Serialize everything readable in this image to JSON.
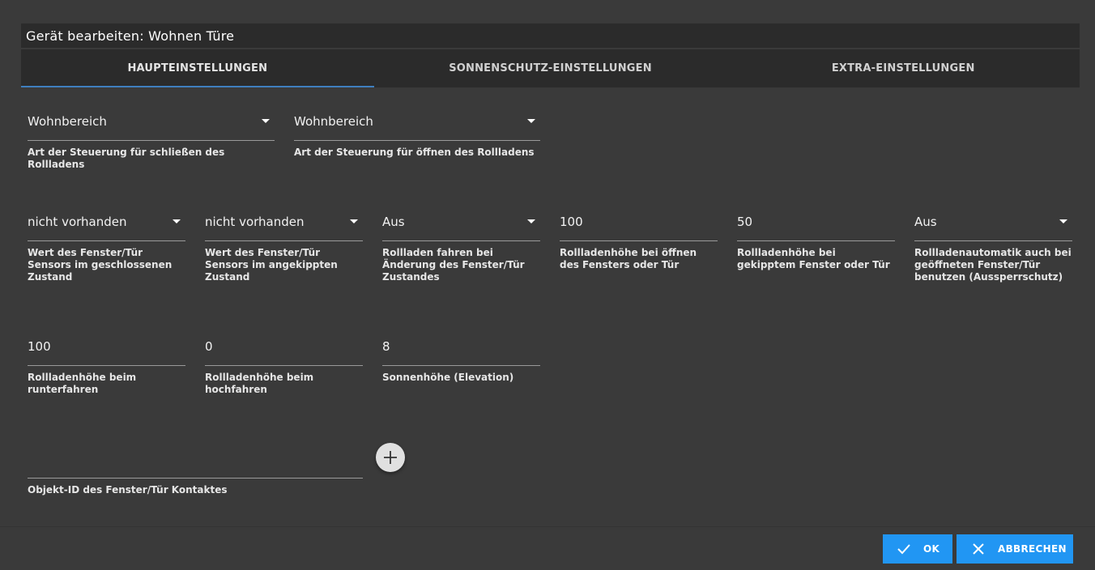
{
  "dialog": {
    "title": "Gerät bearbeiten: Wohnen Türe"
  },
  "tabs": [
    {
      "label": "HAUPTEINSTELLUNGEN",
      "active": true
    },
    {
      "label": "SONNENSCHUTZ-EINSTELLUNGEN",
      "active": false
    },
    {
      "label": "EXTRA-EINSTELLUNGEN",
      "active": false
    }
  ],
  "fields": {
    "close_control": {
      "value": "Wohnbereich",
      "label": "Art der Steuerung für schließen des Rollladens"
    },
    "open_control": {
      "value": "Wohnbereich",
      "label": "Art der Steuerung für öffnen des Rollladens"
    },
    "sensor_closed": {
      "value": "nicht vorhanden",
      "label": "Wert des Fenster/Tür Sensors im geschlossenen Zustand"
    },
    "sensor_tilted": {
      "value": "nicht vorhanden",
      "label": "Wert des Fenster/Tür Sensors im angekippten Zustand"
    },
    "move_on_change": {
      "value": "Aus",
      "label": "Rollladen fahren bei Änderung des Fenster/Tür Zustandes"
    },
    "height_open": {
      "value": "100",
      "label": "Rollladenhöhe bei öffnen des Fensters oder Tür"
    },
    "height_tilted": {
      "value": "50",
      "label": "Rollladenhöhe bei gekipptem Fenster oder Tür"
    },
    "lockout": {
      "value": "Aus",
      "label": "Rollladenautomatik auch bei geöffneten Fenster/Tür benutzen (Aussperrschutz)"
    },
    "height_down": {
      "value": "100",
      "label": "Rollladenhöhe beim runterfahren"
    },
    "height_up": {
      "value": "0",
      "label": "Rollladenhöhe beim hochfahren"
    },
    "elevation": {
      "value": "8",
      "label": "Sonnenhöhe (Elevation)"
    },
    "contact_id": {
      "value": "",
      "label": "Objekt-ID des Fenster/Tür Kontaktes"
    }
  },
  "buttons": {
    "ok": "OK",
    "cancel": "ABBRECHEN"
  },
  "colors": {
    "accent": "#2196f3",
    "tab_indicator": "#3f7fbf"
  }
}
